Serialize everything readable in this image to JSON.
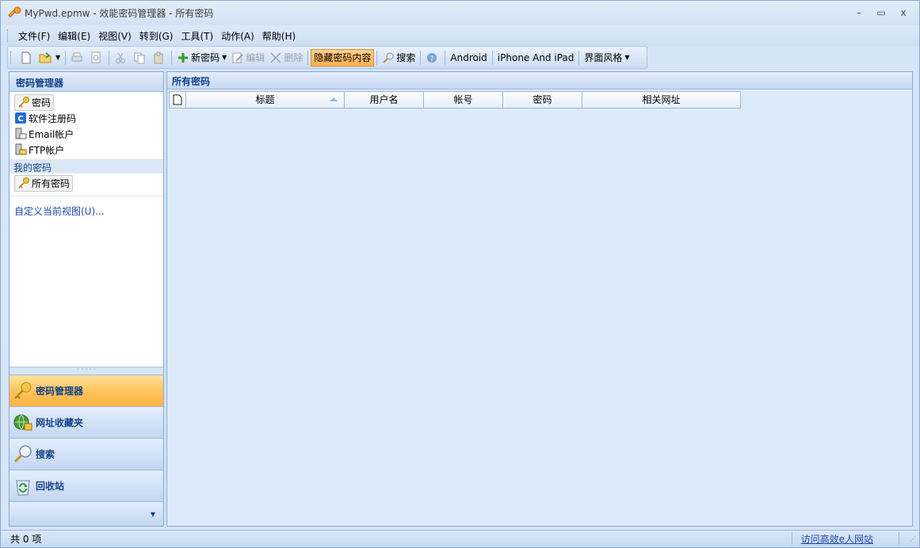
{
  "window": {
    "title": "MyPwd.epmw - 效能密码管理器 - 所有密码",
    "controls": {
      "minimize": "–",
      "maximize": "▭",
      "close": "x"
    }
  },
  "menu": [
    "文件(F)",
    "编辑(E)",
    "视图(V)",
    "转到(G)",
    "工具(T)",
    "动作(A)",
    "帮助(H)"
  ],
  "toolbar": {
    "new_password": "新密码",
    "edit": "编辑",
    "delete": "删除",
    "hide_content": "隐藏密码内容",
    "search": "搜索",
    "android": "Android",
    "iphone": "iPhone And iPad",
    "skin": "界面风格"
  },
  "nav": {
    "header": "密码管理器",
    "items": [
      {
        "label": "密码",
        "icon": "key-icon"
      },
      {
        "label": "软件注册码",
        "icon": "c-icon"
      },
      {
        "label": "Email帐户",
        "icon": "email-server-icon"
      },
      {
        "label": "FTP帐户",
        "icon": "ftp-server-icon"
      }
    ],
    "group_title": "我的密码",
    "group_item": "所有密码",
    "customize_link": "自定义当前视图(U)...",
    "buttons": [
      "密码管理器",
      "网址收藏夹",
      "搜索",
      "回收站"
    ]
  },
  "main": {
    "header": "所有密码",
    "columns": [
      "标题",
      "用户名",
      "帐号",
      "密码",
      "相关网址"
    ]
  },
  "status": {
    "count": "共 0 项",
    "link": "访问高效e人网站"
  },
  "colors": {
    "accent": "#15428b",
    "active_orange": "#ffb340",
    "frame_blue": "#8aa9d4"
  }
}
